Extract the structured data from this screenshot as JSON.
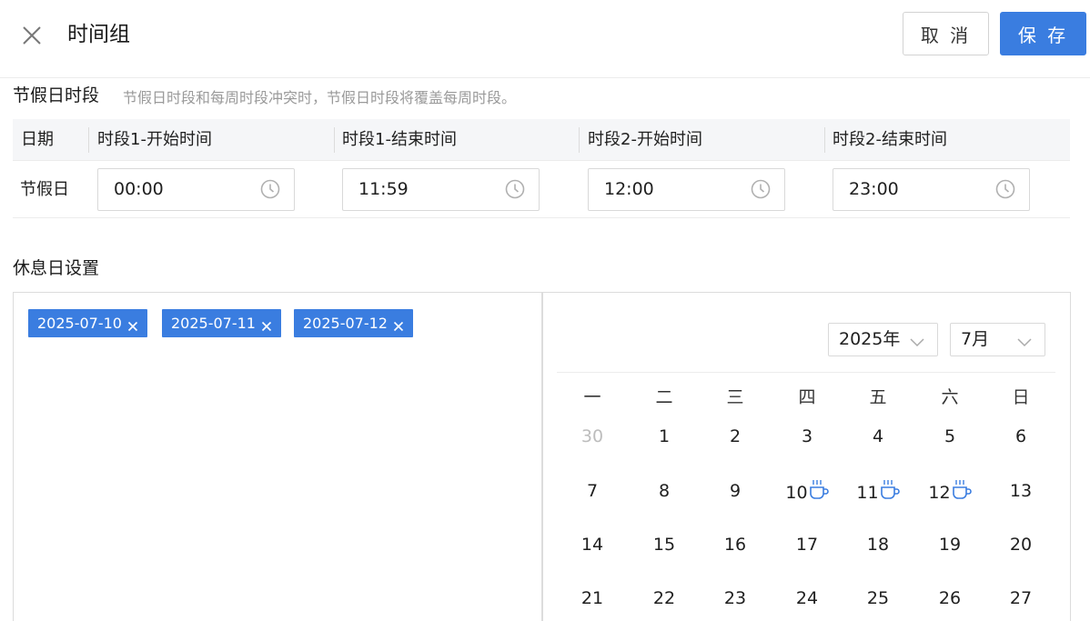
{
  "header": {
    "title": "时间组",
    "cancel_label": "取 消",
    "save_label": "保 存"
  },
  "holiday_section": {
    "title": "节假日时段",
    "hint": "节假日时段和每周时段冲突时，节假日时段将覆盖每周时段。",
    "columns": [
      "日期",
      "时段1-开始时间",
      "时段1-结束时间",
      "时段2-开始时间",
      "时段2-结束时间"
    ],
    "row": {
      "label": "节假日",
      "times": [
        "00:00",
        "11:59",
        "12:00",
        "23:00"
      ]
    }
  },
  "rest_section": {
    "title": "休息日设置",
    "tags": [
      "2025-07-10",
      "2025-07-11",
      "2025-07-12"
    ]
  },
  "calendar": {
    "year_label": "2025年",
    "month_label": "7月",
    "weekdays": [
      "一",
      "二",
      "三",
      "四",
      "五",
      "六",
      "日"
    ],
    "weeks": [
      [
        "30",
        "1",
        "2",
        "3",
        "4",
        "5",
        "6"
      ],
      [
        "7",
        "8",
        "9",
        "10",
        "11",
        "12",
        "13"
      ],
      [
        "14",
        "15",
        "16",
        "17",
        "18",
        "19",
        "20"
      ],
      [
        "21",
        "22",
        "23",
        "24",
        "25",
        "26",
        "27"
      ]
    ],
    "muted_days": [
      "30"
    ],
    "rest_days": [
      "10",
      "11",
      "12"
    ],
    "accent_color": "#3a7de0"
  }
}
